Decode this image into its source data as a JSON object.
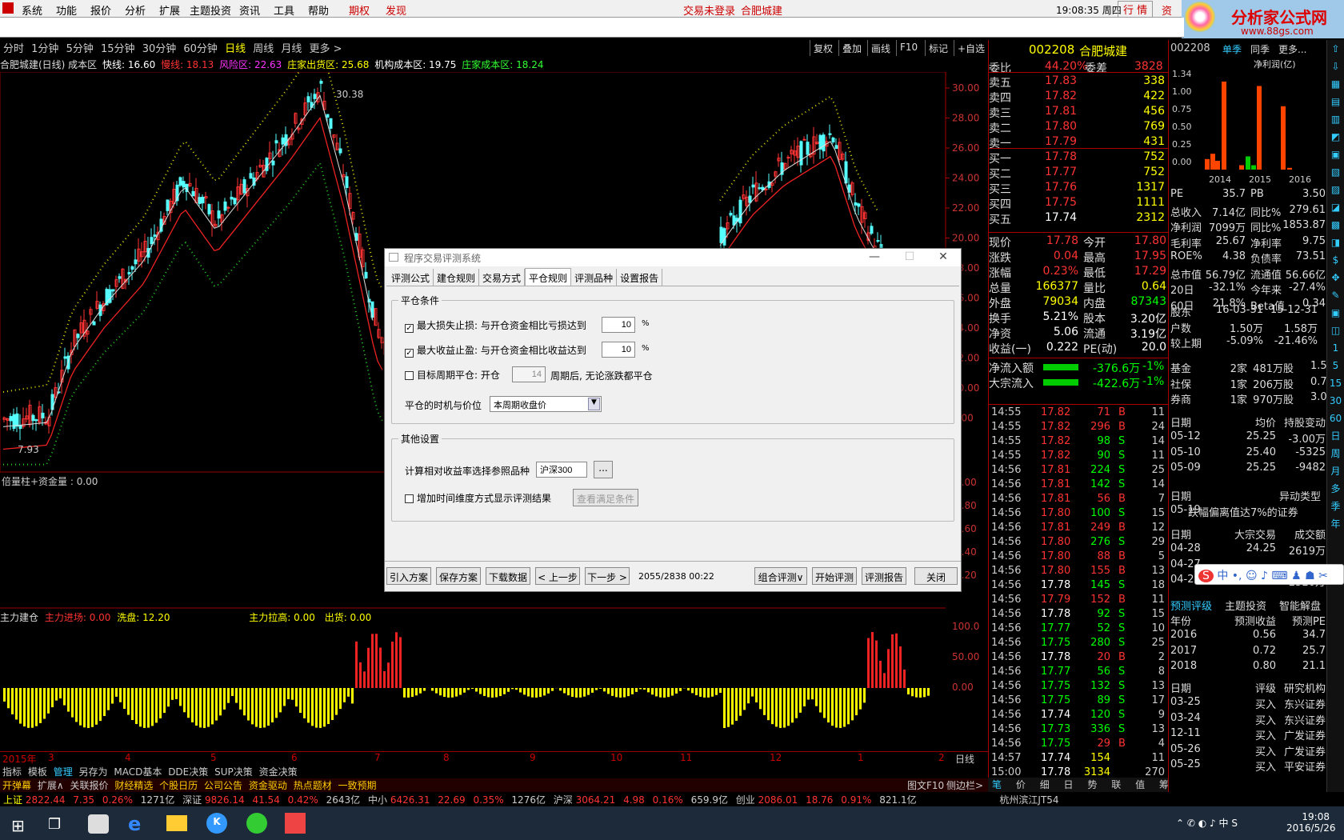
{
  "menu": {
    "items": [
      "系统",
      "功能",
      "报价",
      "分析",
      "扩展",
      "主题投资",
      "资讯",
      "工具",
      "帮助"
    ],
    "qq": "期权",
    "fx": "发现",
    "login": "交易未登录",
    "stock": "合肥城建",
    "time": "19:08:35 周四",
    "b1": "行",
    "b2": "情",
    "b3": "资"
  },
  "toolbar": {
    "periods": [
      "分时",
      "1分钟",
      "5分钟",
      "15分钟",
      "30分钟",
      "60分钟",
      "日线",
      "周线",
      "月线",
      "更多 >"
    ],
    "right": [
      "复权",
      "叠加",
      "画线",
      "F10",
      "标记",
      "+自选"
    ]
  },
  "legend": {
    "title": "合肥城建(日线) 成本区",
    "fast": "快线: 16.60",
    "slow": "慢线: 18.13",
    "risk": "风险区: 22.63",
    "out": "庄家出货区: 25.68",
    "inst": "机构成本区: 19.75",
    "cost": "庄家成本区: 18.24"
  },
  "chart": {
    "peak1": "30.38",
    "low1": "7.93",
    "yaxis": [
      "30.00",
      "28.00",
      "26.00",
      "24.00",
      "22.00",
      "20.00",
      "18.00",
      "16.00",
      "14.00",
      "12.00",
      "10.00",
      "8.00"
    ],
    "vol_label": "倍量柱+资金量 : 0.00",
    "vol_axis": [
      "1.00",
      "0.80",
      "0.60",
      "0.40",
      "0.20"
    ],
    "ind_label": "主力建仓",
    "ind_in": "主力进场: 0.00",
    "ind_wash": "洗盘: 12.20",
    "ind_pull": "主力拉高: 0.00",
    "ind_out": "出货: 0.00",
    "ind_axis": [
      "100.0",
      "50.00",
      "0.00"
    ],
    "xaxis": [
      "2015年",
      "3",
      "4",
      "5",
      "6",
      "7",
      "8",
      "9",
      "10",
      "11",
      "12",
      "1",
      "2"
    ],
    "xaxis_tag": "日线"
  },
  "dialog": {
    "title": "程序交易评测系统",
    "tabs": [
      "评测公式",
      "建仓规则",
      "交易方式",
      "平仓规则",
      "评测品种",
      "设置报告"
    ],
    "g1": "平仓条件",
    "r1": "最大损失止损: 与开仓资金相比亏损达到",
    "v1": "10",
    "r2": "最大收益止盈: 与开仓资金相比收益达到",
    "v2": "10",
    "pct": "%",
    "r3a": "目标周期平仓: 开仓",
    "v3": "14",
    "r3b": "周期后, 无论涨跌都平仓",
    "r4": "平仓的时机与价位",
    "sel": "本周期收盘价",
    "g2": "其他设置",
    "r5": "计算相对收益率选择参照品种",
    "v5": "沪深300",
    "dots": "...",
    "r6": "增加时间维度方式显示评测结果",
    "btn_cond": "查看满足条件",
    "b": [
      "引入方案",
      "保存方案",
      "下载数据",
      "< 上一步",
      "下一步 >"
    ],
    "progress": "2055/2838 00:22",
    "b2": [
      "组合评测∨",
      "开始评测",
      "评测报告",
      "关闭"
    ]
  },
  "quote": {
    "code": "002208",
    "name": "合肥城建",
    "wb": "委比",
    "wbv": "44.20%",
    "wc": "委差",
    "wcv": "3828",
    "sells": [
      [
        "卖五",
        "17.83",
        "338"
      ],
      [
        "卖四",
        "17.82",
        "422"
      ],
      [
        "卖三",
        "17.81",
        "456"
      ],
      [
        "卖二",
        "17.80",
        "769"
      ],
      [
        "卖一",
        "17.79",
        "431"
      ]
    ],
    "buys": [
      [
        "买一",
        "17.78",
        "752"
      ],
      [
        "买二",
        "17.77",
        "752"
      ],
      [
        "买三",
        "17.76",
        "1317"
      ],
      [
        "买四",
        "17.75",
        "1111"
      ],
      [
        "买五",
        "17.74",
        "2312"
      ]
    ],
    "stats": [
      [
        "现价",
        "17.78",
        "今开",
        "17.80"
      ],
      [
        "涨跌",
        "0.04",
        "最高",
        "17.95"
      ],
      [
        "涨幅",
        "0.23%",
        "最低",
        "17.29"
      ],
      [
        "总量",
        "166377",
        "量比",
        "0.64"
      ],
      [
        "外盘",
        "79034",
        "内盘",
        "87343"
      ],
      [
        "换手",
        "5.21%",
        "股本",
        "3.20亿"
      ],
      [
        "净资",
        "5.06",
        "流通",
        "3.19亿"
      ],
      [
        "收益(一)",
        "0.222",
        "PE(动)",
        "20.0"
      ]
    ],
    "flow1": "净流入额",
    "flow1v": "-376.6万",
    "flow1p": "-1%",
    "flow2": "大宗流入",
    "flow2v": "-422.6万",
    "flow2p": "-1%",
    "ticks": [
      [
        "14:55",
        "17.82",
        "71",
        "B",
        "11"
      ],
      [
        "14:55",
        "17.82",
        "296",
        "B",
        "24"
      ],
      [
        "14:55",
        "17.82",
        "98",
        "S",
        "14"
      ],
      [
        "14:55",
        "17.82",
        "90",
        "S",
        "11"
      ],
      [
        "14:56",
        "17.81",
        "224",
        "S",
        "25"
      ],
      [
        "14:56",
        "17.81",
        "142",
        "S",
        "14"
      ],
      [
        "14:56",
        "17.81",
        "56",
        "B",
        "7"
      ],
      [
        "14:56",
        "17.80",
        "100",
        "S",
        "15"
      ],
      [
        "14:56",
        "17.81",
        "249",
        "B",
        "12"
      ],
      [
        "14:56",
        "17.80",
        "276",
        "S",
        "29"
      ],
      [
        "14:56",
        "17.80",
        "88",
        "B",
        "5"
      ],
      [
        "14:56",
        "17.80",
        "155",
        "B",
        "13"
      ],
      [
        "14:56",
        "17.78",
        "145",
        "S",
        "18"
      ],
      [
        "14:56",
        "17.79",
        "152",
        "B",
        "11"
      ],
      [
        "14:56",
        "17.78",
        "92",
        "S",
        "15"
      ],
      [
        "14:56",
        "17.77",
        "52",
        "S",
        "10"
      ],
      [
        "14:56",
        "17.75",
        "280",
        "S",
        "25"
      ],
      [
        "14:56",
        "17.78",
        "20",
        "B",
        "2"
      ],
      [
        "14:56",
        "17.77",
        "56",
        "S",
        "8"
      ],
      [
        "14:56",
        "17.75",
        "132",
        "S",
        "13"
      ],
      [
        "14:56",
        "17.75",
        "89",
        "S",
        "17"
      ],
      [
        "14:56",
        "17.74",
        "120",
        "S",
        "9"
      ],
      [
        "14:56",
        "17.73",
        "336",
        "S",
        "13"
      ],
      [
        "14:56",
        "17.75",
        "29",
        "B",
        "4"
      ],
      [
        "14:57",
        "17.74",
        "154",
        "",
        "11"
      ],
      [
        "15:00",
        "17.78",
        "3134",
        "",
        "270"
      ]
    ]
  },
  "f10": {
    "code": "002208",
    "tabs": [
      "单季",
      "同季",
      "更多..."
    ],
    "chart_title": "净利润(亿)",
    "yax": [
      "1.34",
      "1.00",
      "0.75",
      "0.50",
      "0.25",
      "0.00"
    ],
    "years": [
      "2014",
      "2015",
      "2016"
    ],
    "rows": [
      [
        "PE",
        "35.7",
        "PB",
        "3.50"
      ],
      [
        "总收入",
        "7.14亿",
        "同比%",
        "279.61"
      ],
      [
        "净利润",
        "7099万",
        "同比%",
        "1853.87"
      ],
      [
        "毛利率",
        "25.67",
        "净利率",
        "9.75"
      ],
      [
        "ROE%",
        "4.38",
        "负债率",
        "73.51"
      ],
      [
        "总市值",
        "56.79亿",
        "流通值",
        "56.66亿"
      ],
      [
        "20日",
        "-32.1%",
        "今年来",
        "-27.4%"
      ],
      [
        "60日",
        "21.8%",
        "Beta值",
        "0.34"
      ]
    ],
    "sh": [
      [
        "股东",
        "16-03-31",
        "15-12-31"
      ],
      [
        "户数",
        "1.50万",
        "1.58万"
      ],
      [
        "较上期",
        "-5.09%",
        "-21.46%"
      ]
    ],
    "fund": [
      [
        "基金",
        "2家",
        "481万股",
        "1.5%"
      ],
      [
        "社保",
        "1家",
        "206万股",
        "0.7%"
      ],
      [
        "券商",
        "1家",
        "970万股",
        "3.0%"
      ]
    ],
    "trade_h": [
      "日期",
      "均价",
      "持股变动"
    ],
    "trade": [
      [
        "05-12",
        "25.25",
        "-3.00万"
      ],
      [
        "05-10",
        "25.40",
        "-5325"
      ],
      [
        "05-09",
        "25.25",
        "-9482"
      ]
    ],
    "ab_h": [
      "日期",
      "异动类型"
    ],
    "ab": [
      [
        "05-19",
        "跌幅偏离值达7%的证券"
      ]
    ],
    "bt_h": [
      "日期",
      "大宗交易",
      "成交额"
    ],
    "bt": [
      [
        "04-28",
        "24.25",
        "2619万"
      ],
      [
        "04-27",
        "",
        ""
      ],
      [
        "04-26",
        "25.25",
        "2520万"
      ]
    ],
    "ptabs": [
      "预测评级",
      "主题投资",
      "智能解盘"
    ],
    "fc_h": [
      "年份",
      "预测收益",
      "预测PE"
    ],
    "fc": [
      [
        "2016",
        "0.56",
        "34.7"
      ],
      [
        "2017",
        "0.72",
        "25.7"
      ],
      [
        "2018",
        "0.80",
        "21.1"
      ]
    ],
    "rt_h": [
      "日期",
      "评级",
      "研究机构"
    ],
    "rt": [
      [
        "03-25",
        "买入",
        "东兴证券"
      ],
      [
        "03-24",
        "买入",
        "东兴证券"
      ],
      [
        "12-11",
        "买入",
        "广发证券"
      ],
      [
        "05-26",
        "买入",
        "广发证券"
      ],
      [
        "05-25",
        "买入",
        "平安证券"
      ]
    ]
  },
  "bottom": {
    "tabs1": [
      "指标",
      "模板",
      "管理",
      "另存为",
      "MACD基本",
      "DDE决策",
      "SUP决策",
      "资金决策"
    ],
    "tabs2": [
      "开弹幕",
      "扩展∧",
      "关联报价",
      "财经精选",
      "个股日历",
      "公司公告",
      "资金驱动",
      "热点题材",
      "一致预期"
    ],
    "rt": [
      "图文F10",
      "侧边栏>"
    ],
    "qtabs": [
      "笔",
      "价",
      "细",
      "日",
      "势",
      "联",
      "值",
      "筹"
    ]
  },
  "index": [
    "上证",
    "2822.44",
    "7.35",
    "0.26%",
    "1271亿",
    "深证",
    "9826.14",
    "41.54",
    "0.42%",
    "2643亿",
    "中小",
    "6426.31",
    "22.69",
    "0.35%",
    "1276亿",
    "沪深",
    "3064.21",
    "4.98",
    "0.16%",
    "659.9亿",
    "创业",
    "2086.01",
    "18.76",
    "0.91%",
    "821.1亿",
    "杭州滨江JT54"
  ],
  "sys": {
    "ime": "中",
    "time": "19:08",
    "date": "2016/5/26"
  },
  "logo": {
    "text": "分析家公式网",
    "url": "www.88gs.com"
  }
}
